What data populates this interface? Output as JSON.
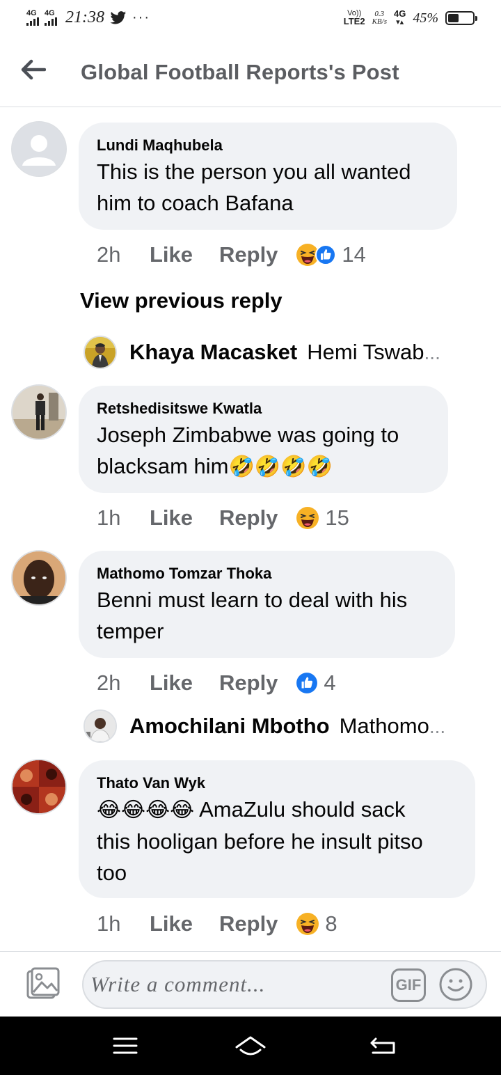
{
  "status_bar": {
    "sim1": "4G",
    "sim2": "4G",
    "time": "21:38",
    "overflow": "···",
    "volte_top": "Vo))",
    "volte_bottom": "LTE2",
    "speed_value": "0.3",
    "speed_unit": "KB/s",
    "network": "4G",
    "battery_percent": "45%",
    "battery_level": 0.45,
    "icons": [
      "twitter-icon",
      "battery-icon"
    ]
  },
  "header": {
    "title": "Global Football Reports's Post",
    "back_icon": "back-arrow-icon"
  },
  "comments": [
    {
      "author": "Lundi Maqhubela",
      "line1": "This is the person you all wanted",
      "line2": "him to coach Bafana",
      "time": "2h",
      "like_label": "Like",
      "reply_label": "Reply",
      "reactions": [
        "haha",
        "like"
      ],
      "reaction_count": "14"
    },
    {
      "author": "Retshedisitswe Kwatla",
      "line1": "Joseph Zimbabwe was going to",
      "line2": "blacksam him",
      "emojis": [
        "🤣",
        "🤣",
        "🤣",
        "🤣"
      ],
      "time": "1h",
      "like_label": "Like",
      "reply_label": "Reply",
      "reactions": [
        "haha"
      ],
      "reaction_count": "15"
    },
    {
      "author": "Mathomo Tomzar Thoka",
      "line1": "Benni must learn to deal with his",
      "line2": "temper",
      "time": "2h",
      "like_label": "Like",
      "reply_label": "Reply",
      "reactions": [
        "like"
      ],
      "reaction_count": "4"
    },
    {
      "author": "Thato Van Wyk",
      "emojis": [
        "😂",
        "😂",
        "😂",
        "😂"
      ],
      "line1": "AmaZulu should sack",
      "line2": "this hooligan before he insult pitso",
      "line3": "too",
      "time": "1h",
      "like_label": "Like",
      "reply_label": "Reply",
      "reactions": [
        "haha"
      ],
      "reaction_count": "8"
    }
  ],
  "view_previous": "View previous reply",
  "replies": [
    {
      "name": "Khaya Macasket",
      "snippet": "Hemi Tswab",
      "ellipsis": "..."
    },
    {
      "name": "Amochilani Mbotho",
      "snippet": "Mathomo",
      "ellipsis": "..."
    }
  ],
  "composer": {
    "placeholder": "Write a comment...",
    "gif_label": "GIF"
  },
  "colors": {
    "bubble": "#f0f2f5",
    "secondary_text": "#65676b",
    "like_blue": "#1877f2",
    "haha_yellow": "#f7b125"
  }
}
